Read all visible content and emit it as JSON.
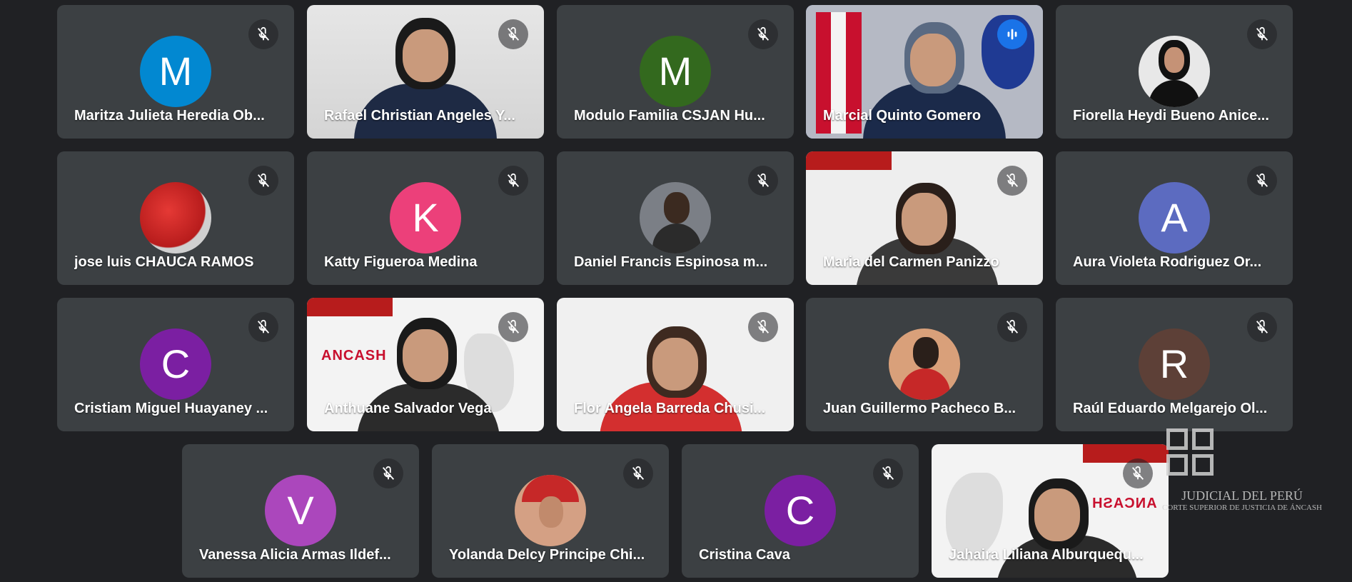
{
  "participants": [
    {
      "name": "Maritza Julieta Heredia Ob...",
      "initial": "M",
      "color": "#0288d1"
    },
    {
      "name": "Rafael Christian Angeles Y..."
    },
    {
      "name": "Modulo Familia CSJAN Hu...",
      "initial": "M",
      "color": "#33691e"
    },
    {
      "name": "Marcial Quinto Gomero",
      "speaking": true
    },
    {
      "name": "Fiorella Heydi Bueno Anice..."
    },
    {
      "name": "jose luis CHAUCA RAMOS"
    },
    {
      "name": "Katty Figueroa Medina",
      "initial": "K",
      "color": "#ec407a"
    },
    {
      "name": "Daniel Francis Espinosa m..."
    },
    {
      "name": "Maria del Carmen Panizzo"
    },
    {
      "name": "Aura Violeta Rodriguez Or...",
      "initial": "A",
      "color": "#5c6bc0"
    },
    {
      "name": "Cristiam Miguel Huayaney ...",
      "initial": "C",
      "color": "#7b1fa2"
    },
    {
      "name": "Anthuane Salvador Vega",
      "slide_word": "ANCASH"
    },
    {
      "name": "Flor Angela Barreda Chusi..."
    },
    {
      "name": "Juan Guillermo Pacheco B..."
    },
    {
      "name": "Raúl Eduardo Melgarejo Ol...",
      "initial": "R",
      "color": "#5d4037"
    },
    {
      "name": "Vanessa Alicia Armas Ildef...",
      "initial": "V",
      "color": "#ab47bc"
    },
    {
      "name": "Yolanda Delcy Principe Chi..."
    },
    {
      "name": "Cristina Cava",
      "initial": "C",
      "color": "#7b1fa2"
    },
    {
      "name": "Jahaira Liliana Alburquequ...",
      "slide_word": "ANCASH"
    }
  ],
  "watermark": {
    "line1": "JUDICIAL DEL PERÚ",
    "line2": "CORTE SUPERIOR DE JUSTICIA DE ÁNCASH"
  },
  "icons": {
    "muted": "mic-off-icon",
    "speaking": "audio-level-icon"
  },
  "colors": {
    "background": "#202124",
    "tile": "#3c4043",
    "speaking_border": "#8ab4f8",
    "slide_red": "#c8102e"
  }
}
